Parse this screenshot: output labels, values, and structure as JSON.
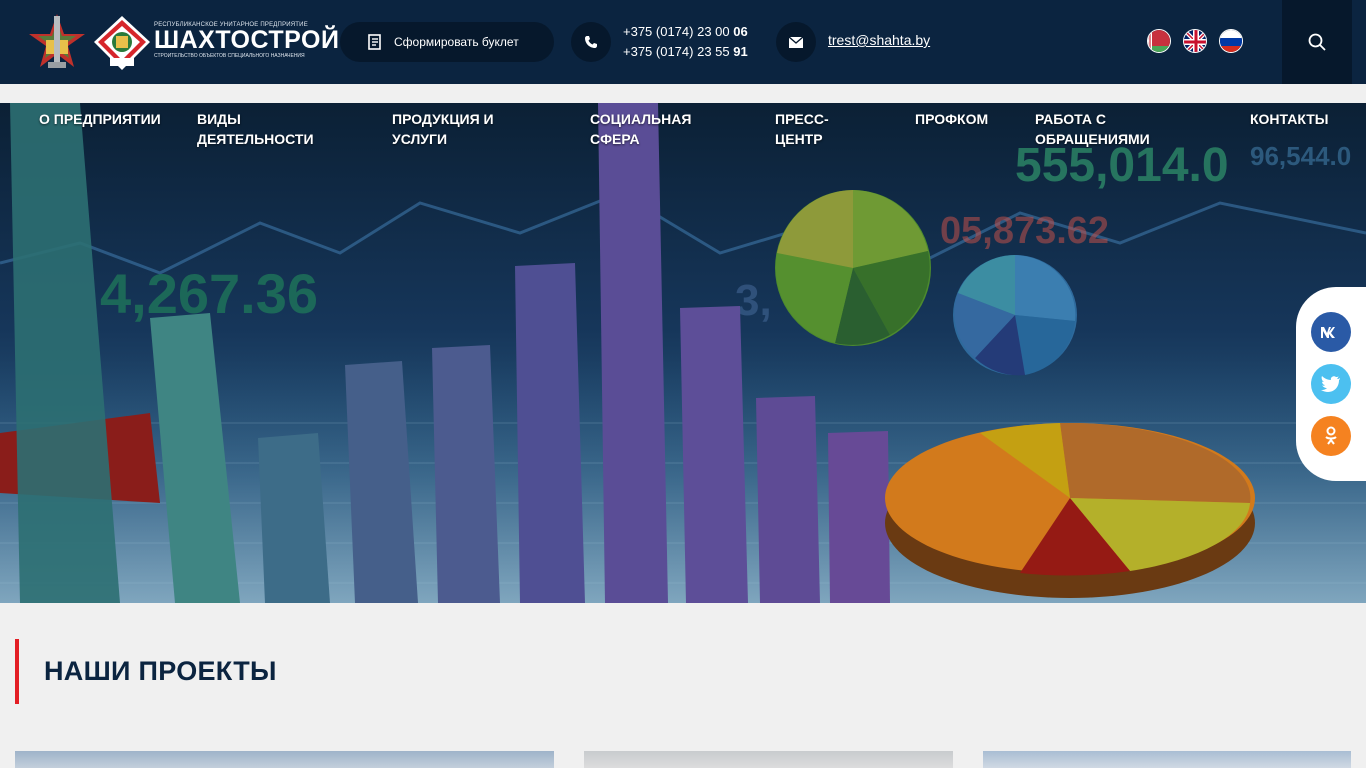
{
  "header": {
    "logo_top_line": "РЕСПУБЛИКАНСКОЕ УНИТАРНОЕ ПРЕДПРИЯТИЕ",
    "logo_title": "ШАХТОСТРОЙ",
    "logo_bottom_line": "СТРОИТЕЛЬСТВО ОБЪЕКТОВ СПЕЦИАЛЬНОГО НАЗНАЧЕНИЯ",
    "booklet_label": "Сформировать буклет",
    "phone1_prefix": "+375 (0174) 23 00 ",
    "phone1_suffix": "06",
    "phone2_prefix": "+375 (0174) 23 55 ",
    "phone2_suffix": "91",
    "email": "trest@shahta.by",
    "languages": [
      "be",
      "en",
      "ru"
    ],
    "icons": {
      "booklet": "booklet-icon",
      "phone": "phone-icon",
      "mail": "mail-icon",
      "search": "search-icon"
    }
  },
  "nav": {
    "items": [
      {
        "label": "О ПРЕДПРИЯТИИ"
      },
      {
        "label": "ВИДЫ ДЕЯТЕЛЬНОСТИ"
      },
      {
        "label": "ПРОДУКЦИЯ И УСЛУГИ"
      },
      {
        "label": "СОЦИАЛЬНАЯ СФЕРА"
      },
      {
        "label": "ПРЕСС-ЦЕНТР"
      },
      {
        "label": "ПРОФКОМ"
      },
      {
        "label": "РАБОТА С ОБРАЩЕНИЯМИ"
      },
      {
        "label": "КОНТАКТЫ"
      }
    ]
  },
  "hero": {
    "numbers": [
      "555,014.0",
      "05,873.62",
      "4,267.36",
      "96,544.0",
      "3,"
    ]
  },
  "social": {
    "vk": "VK",
    "twitter": "twitter",
    "ok": "OK"
  },
  "section": {
    "title": "НАШИ ПРОЕКТЫ"
  },
  "colors": {
    "header_bg": "#0b2440",
    "accent_red": "#e31e24",
    "vk": "#2a5aa6",
    "twitter": "#4cc0f0",
    "ok": "#f58220"
  }
}
